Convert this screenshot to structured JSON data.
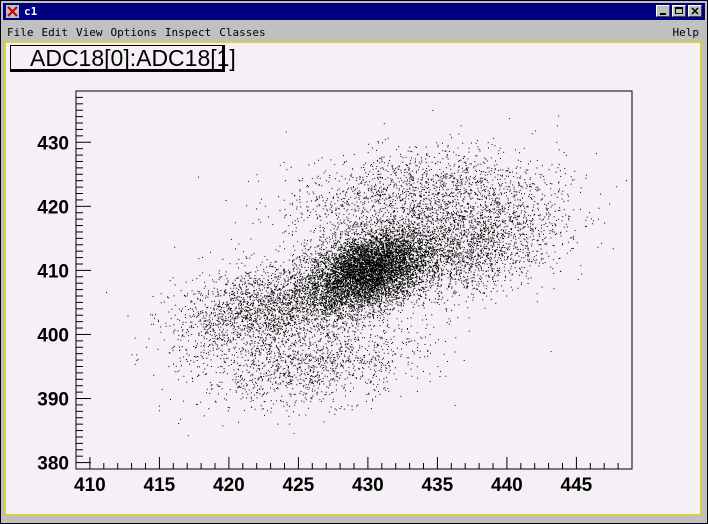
{
  "window": {
    "title": "c1"
  },
  "menu": {
    "items": [
      "File",
      "Edit",
      "View",
      "Options",
      "Inspect",
      "Classes"
    ],
    "help": "Help"
  },
  "colors": {
    "titlebar": "#000080",
    "canvas": "#f5f0f5",
    "frame": "#d8d040"
  },
  "chart_data": {
    "type": "scatter",
    "title": "ADC18[0]:ADC18[1]",
    "xlim": [
      409,
      449
    ],
    "ylim": [
      379,
      438
    ],
    "x_ticks": [
      410,
      415,
      420,
      425,
      430,
      435,
      440,
      445
    ],
    "y_ticks": [
      380,
      390,
      400,
      410,
      420,
      430
    ],
    "grid": false,
    "legend": "none",
    "clusters": [
      {
        "center": [
          430,
          410
        ],
        "sigma": [
          2.2,
          3.0
        ],
        "points": 7000
      },
      {
        "center": [
          423,
          404
        ],
        "sigma": [
          3.5,
          3.5
        ],
        "points": 2500
      },
      {
        "center": [
          437,
          414
        ],
        "sigma": [
          3.5,
          4.0
        ],
        "points": 2500
      },
      {
        "center": [
          433,
          422
        ],
        "sigma": [
          4.5,
          3.5
        ],
        "points": 1600
      },
      {
        "center": [
          426,
          395
        ],
        "sigma": [
          4.0,
          3.0
        ],
        "points": 1200
      }
    ]
  }
}
